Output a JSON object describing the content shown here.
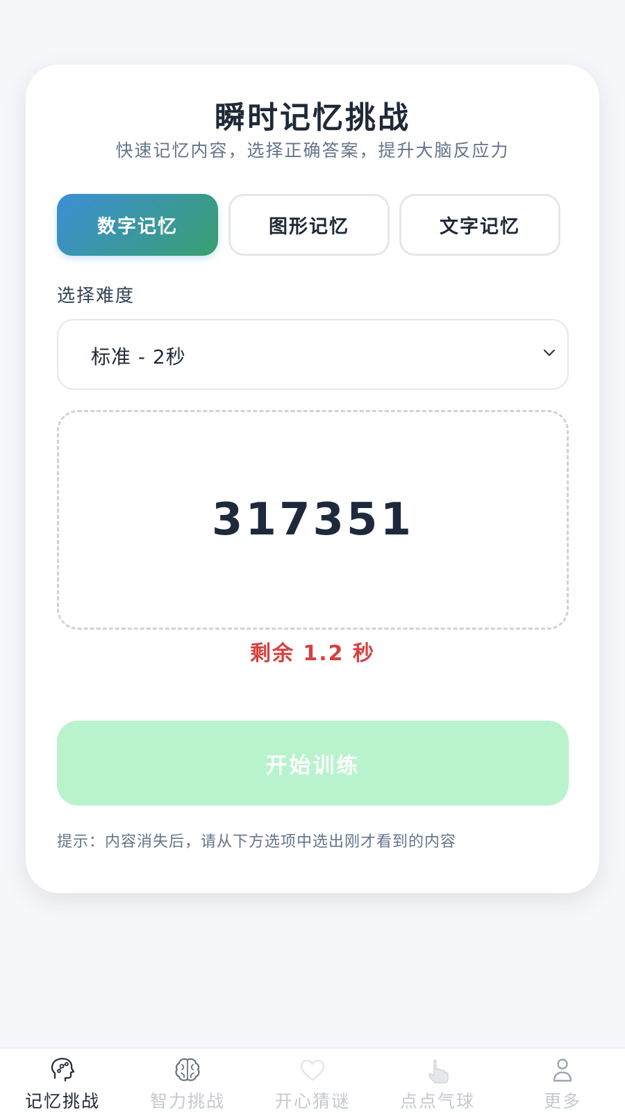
{
  "header": {
    "title": "瞬时记忆挑战",
    "subtitle": "快速记忆内容，选择正确答案，提升大脑反应力"
  },
  "modes": [
    {
      "label": "数字记忆",
      "active": true
    },
    {
      "label": "图形记忆",
      "active": false
    },
    {
      "label": "文字记忆",
      "active": false
    }
  ],
  "difficulty": {
    "label": "选择难度",
    "selected": "标准 - 2秒"
  },
  "memory": {
    "content": "317351"
  },
  "timer": {
    "text": "剩余 1.2 秒"
  },
  "start_button": {
    "label": "开始训练"
  },
  "hint": "提示：内容消失后，请从下方选项中选出刚才看到的内容",
  "tabbar": [
    {
      "label": "记忆挑战",
      "icon": "head-brain-icon",
      "active": true
    },
    {
      "label": "智力挑战",
      "icon": "brain-icon",
      "active": false
    },
    {
      "label": "开心猜谜",
      "icon": "heart-icon",
      "active": false
    },
    {
      "label": "点点气球",
      "icon": "tap-hand-icon",
      "active": false
    },
    {
      "label": "更多",
      "icon": "user-icon",
      "active": false
    }
  ],
  "colors": {
    "accent_gradient_start": "#3b8fd6",
    "accent_gradient_end": "#3a9f6f",
    "timer": "#d64040",
    "start_button_bg": "#b8f3cd"
  }
}
